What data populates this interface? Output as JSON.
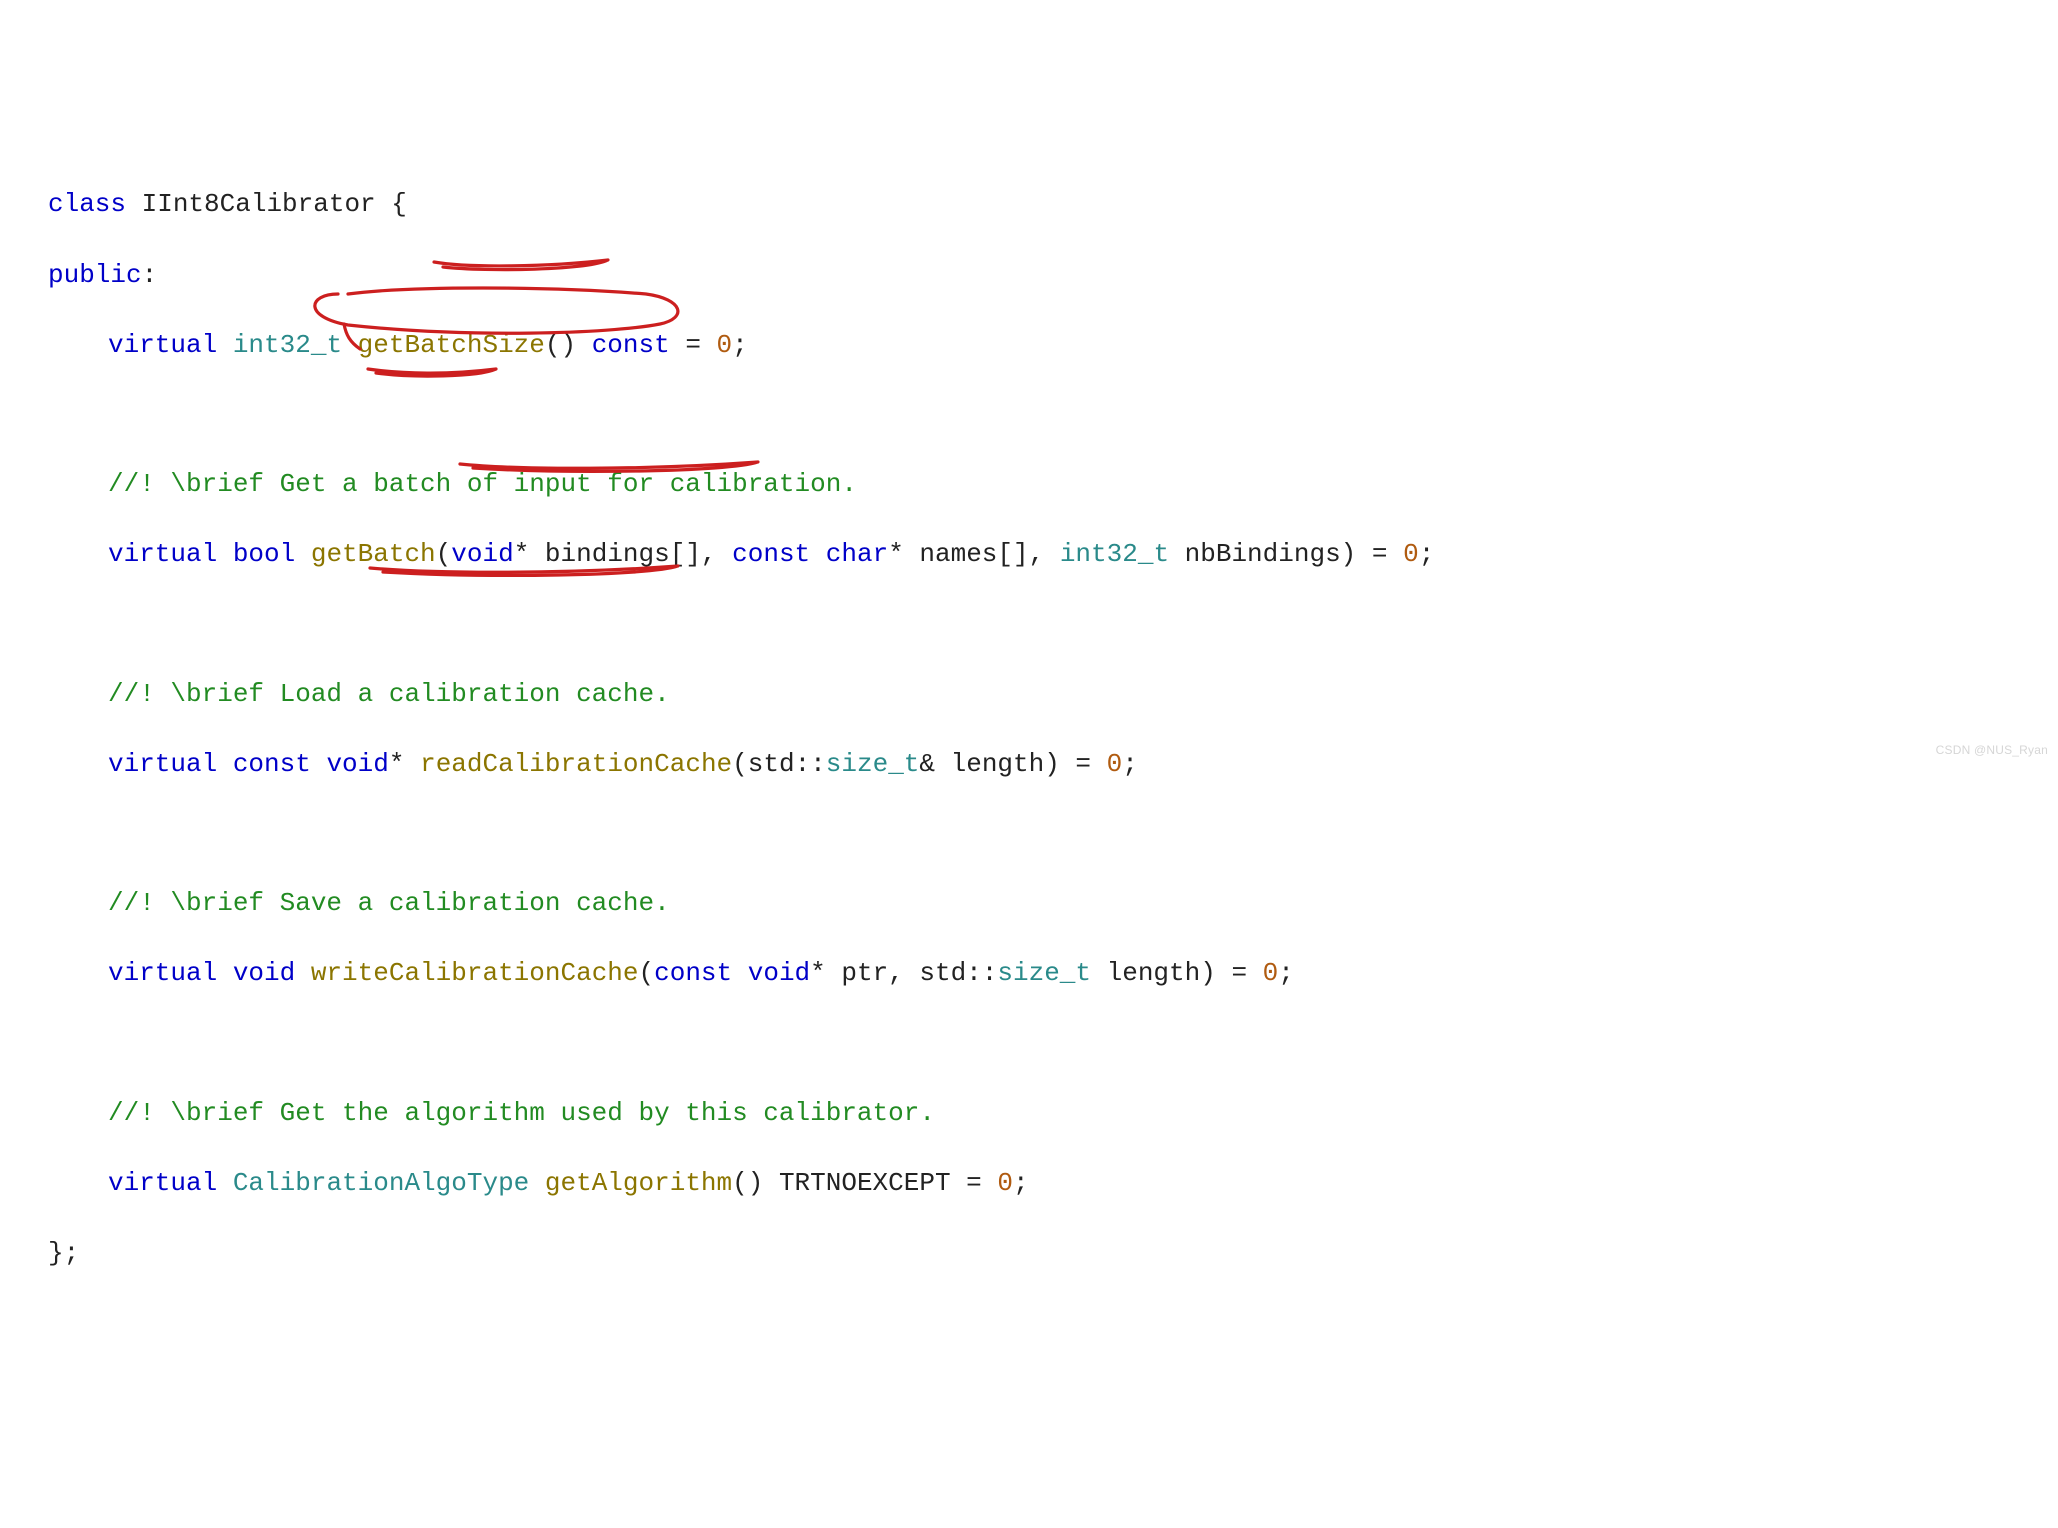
{
  "code": {
    "line1": {
      "kw_class": "class",
      "name": " IInt8Calibrator {"
    },
    "line2": {
      "kw_public": "public",
      "colon": ":"
    },
    "line3": {
      "kw_virtual": "virtual ",
      "type_int32": "int32_t ",
      "fn": "getBatchSize",
      "paren": "() ",
      "kw_const": "const",
      "tail": " = ",
      "zero": "0",
      "semi": ";"
    },
    "c1": "//! \\brief Get a batch of input for calibration.",
    "line4": {
      "kw_virtual": "virtual ",
      "type_bool": "bool ",
      "fn": "getBatch",
      "open": "(",
      "kw_void": "void",
      "star": "* bindings[], ",
      "kw_const": "const ",
      "kw_char": "char",
      "names": "* names[], ",
      "type_int32": "int32_t",
      "nb": " nbBindings) = ",
      "zero": "0",
      "semi": ";"
    },
    "c2": "//! \\brief Load a calibration cache.",
    "line5": {
      "kw_virtual": "virtual ",
      "kw_const": "const ",
      "kw_void": "void",
      "star": "* ",
      "fn": "readCalibrationCache",
      "open": "(std::",
      "type_sizet": "size_t",
      "tail": "& length) = ",
      "zero": "0",
      "semi": ";"
    },
    "c3": "//! \\brief Save a calibration cache.",
    "line6": {
      "kw_virtual": "virtual ",
      "kw_void": "void ",
      "fn": "writeCalibrationCache",
      "open": "(",
      "kw_const": "const ",
      "kw_void2": "void",
      "ptr": "* ptr, std::",
      "type_sizet": "size_t",
      "tail": " length) = ",
      "zero": "0",
      "semi": ";"
    },
    "c4": "//! \\brief Get the algorithm used by this calibrator.",
    "line7": {
      "kw_virtual": "virtual ",
      "type_algotype": "CalibrationAlgoType ",
      "fn": "getAlgorithm",
      "paren": "() ",
      "macro": "TRTNOEXCEPT",
      "tail": " = ",
      "zero": "0",
      "semi": ";"
    },
    "line8": "};"
  },
  "watermark": "CSDN @NUS_Ryan"
}
